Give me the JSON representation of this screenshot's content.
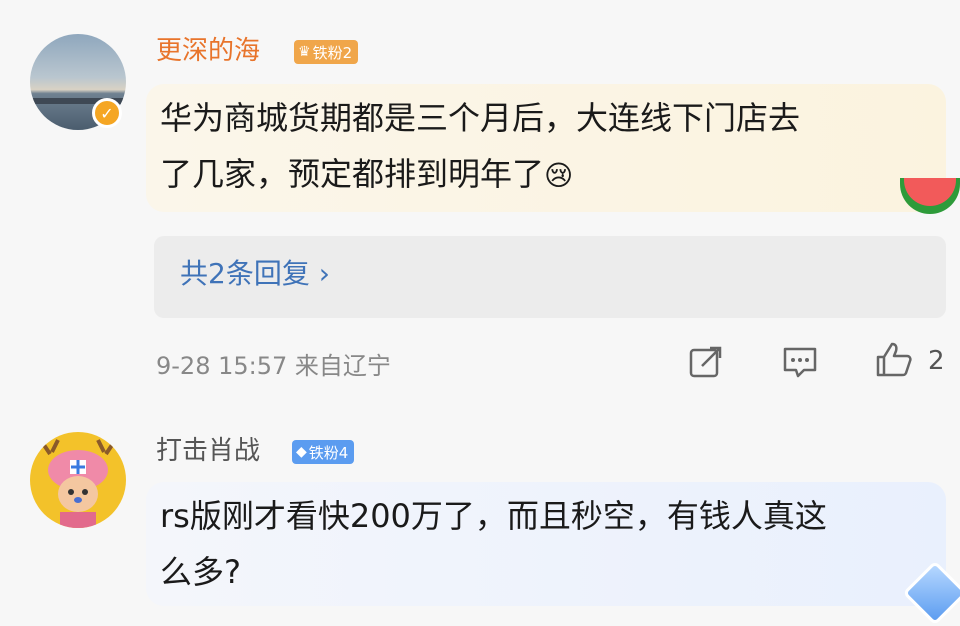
{
  "comments": [
    {
      "username": "更深的海",
      "badge": "铁粉2",
      "text_line1": "华为商城货期都是三个月后，大连线下门店去",
      "text_line2": "了几家，预定都排到明年了",
      "reply_summary": "共2条回复 ›",
      "meta": "9-28 15:57 来自辽宁",
      "likes": "2"
    },
    {
      "username": "打击肖战",
      "badge": "铁粉4",
      "text_line1": "rs版刚才看快200万了，而且秒空，有钱人真这",
      "text_line2": "么多?"
    }
  ],
  "colors": {
    "orange_name": "#e8742b",
    "link_blue": "#3f73b8",
    "badge_orange": "#f0a64a",
    "badge_blue": "#5b9cf0"
  }
}
